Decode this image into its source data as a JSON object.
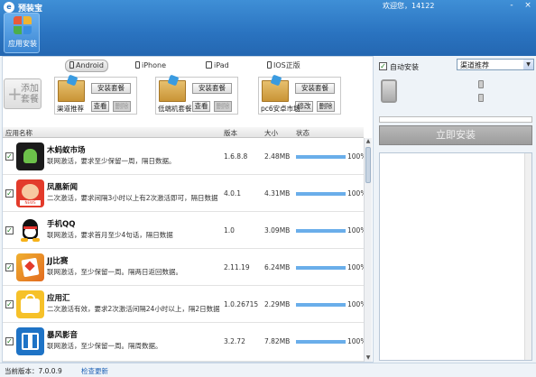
{
  "app": {
    "title": "预装宝",
    "welcome": "欢迎您，14122"
  },
  "window": {
    "min": "-",
    "close": "×"
  },
  "nav": {
    "label": "应用安装"
  },
  "tabs": [
    {
      "label": "Android",
      "active": true
    },
    {
      "label": "iPhone",
      "active": false
    },
    {
      "label": "iPad",
      "active": false
    },
    {
      "label": "IOS正版",
      "active": false
    }
  ],
  "add_package": {
    "label": "添加套餐"
  },
  "packages": [
    {
      "name": "渠道推荐",
      "install": "安装套餐",
      "view": "查看",
      "delete": "删除"
    },
    {
      "name": "低端机套餐",
      "install": "安装套餐",
      "view": "查看",
      "delete": "删除"
    },
    {
      "name": "pc6安卓市场",
      "install": "安装套餐",
      "view": "修改",
      "delete": "删除"
    }
  ],
  "table": {
    "headers": {
      "name": "应用名称",
      "version": "版本",
      "size": "大小",
      "status": "状态"
    },
    "rows": [
      {
        "name": "木蚂蚁市场",
        "desc": "联网激活，要求至少保留一周，隔日数据。",
        "version": "1.6.8.8",
        "size": "2.48MB",
        "progress": "100%",
        "icon": "mumayi-icon",
        "checked": "✓"
      },
      {
        "name": "凤凰新闻",
        "desc": "二次激活，要求间隔3小时以上有2次激活即可，隔日数据",
        "version": "4.0.1",
        "size": "4.31MB",
        "progress": "100%",
        "icon": "ifeng-icon",
        "checked": "✓"
      },
      {
        "name": "手机QQ",
        "desc": "联网激活，要求首月至少4句话，隔日数据",
        "version": "1.0",
        "size": "3.09MB",
        "progress": "100%",
        "icon": "qq-icon",
        "checked": "✓"
      },
      {
        "name": "JJ比赛",
        "desc": "联网激活，至少保留一周。隔两日返回数据。",
        "version": "2.11.19",
        "size": "6.24MB",
        "progress": "100%",
        "icon": "jj-icon",
        "checked": "✓"
      },
      {
        "name": "应用汇",
        "desc": "二次激活有效，要求2次激活间隔24小时以上，隔2日数据",
        "version": "1.0.26715",
        "size": "2.29MB",
        "progress": "100%",
        "icon": "yingyonghui-icon",
        "checked": "✓"
      },
      {
        "name": "暴风影音",
        "desc": "联网激活，至少保留一周。隔周数据。",
        "version": "3.2.72",
        "size": "7.82MB",
        "progress": "100%",
        "icon": "baofeng-icon",
        "checked": "✓"
      }
    ]
  },
  "right": {
    "auto_install": "自动安装",
    "auto_checked": "✓",
    "channel_select": "渠道推荐",
    "install_button": "立即安装"
  },
  "status_bar": {
    "version": "当前版本：7.0.0.9",
    "check_update": "检查更新"
  }
}
